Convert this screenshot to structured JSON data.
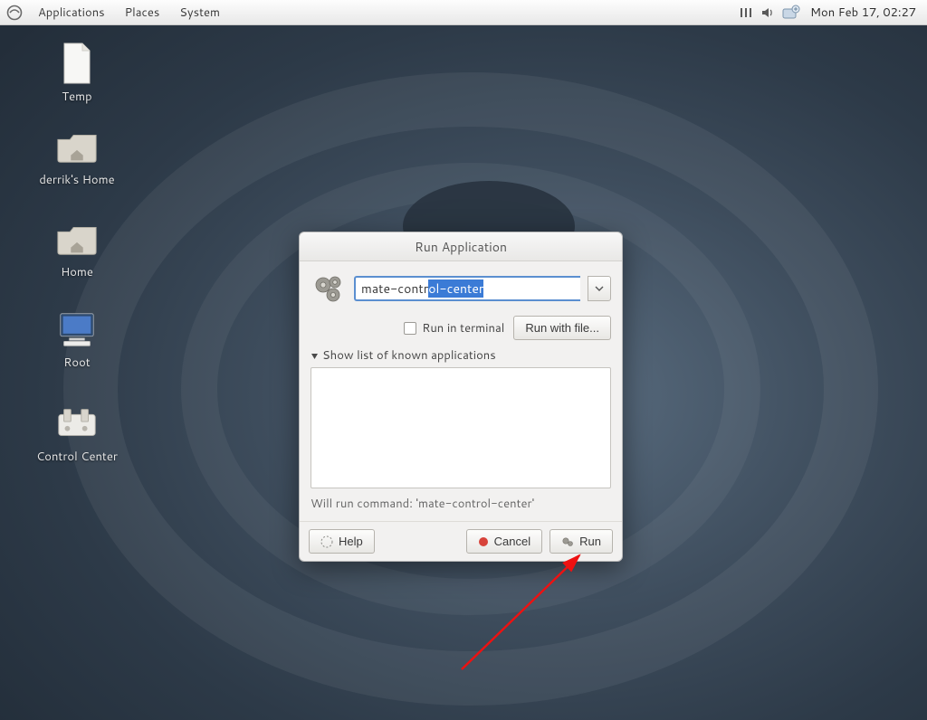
{
  "panel": {
    "menus": [
      "Applications",
      "Places",
      "System"
    ],
    "clock": "Mon Feb 17, 02:27"
  },
  "desktop_icons": [
    {
      "label": "Temp",
      "kind": "file"
    },
    {
      "label": "derrik's Home",
      "kind": "folder-home"
    },
    {
      "label": "Home",
      "kind": "folder-home"
    },
    {
      "label": "Root",
      "kind": "computer"
    },
    {
      "label": "Control Center",
      "kind": "control"
    }
  ],
  "dialog": {
    "title": "Run Application",
    "command_prefix": "mate-contr",
    "command_selected": "ol-center",
    "run_in_terminal_label": "Run in terminal",
    "run_with_file_label": "Run with file...",
    "expander_label": "Show list of known applications",
    "preview": "Will run command: 'mate-control-center'",
    "help_label": "Help",
    "cancel_label": "Cancel",
    "run_label": "Run"
  }
}
